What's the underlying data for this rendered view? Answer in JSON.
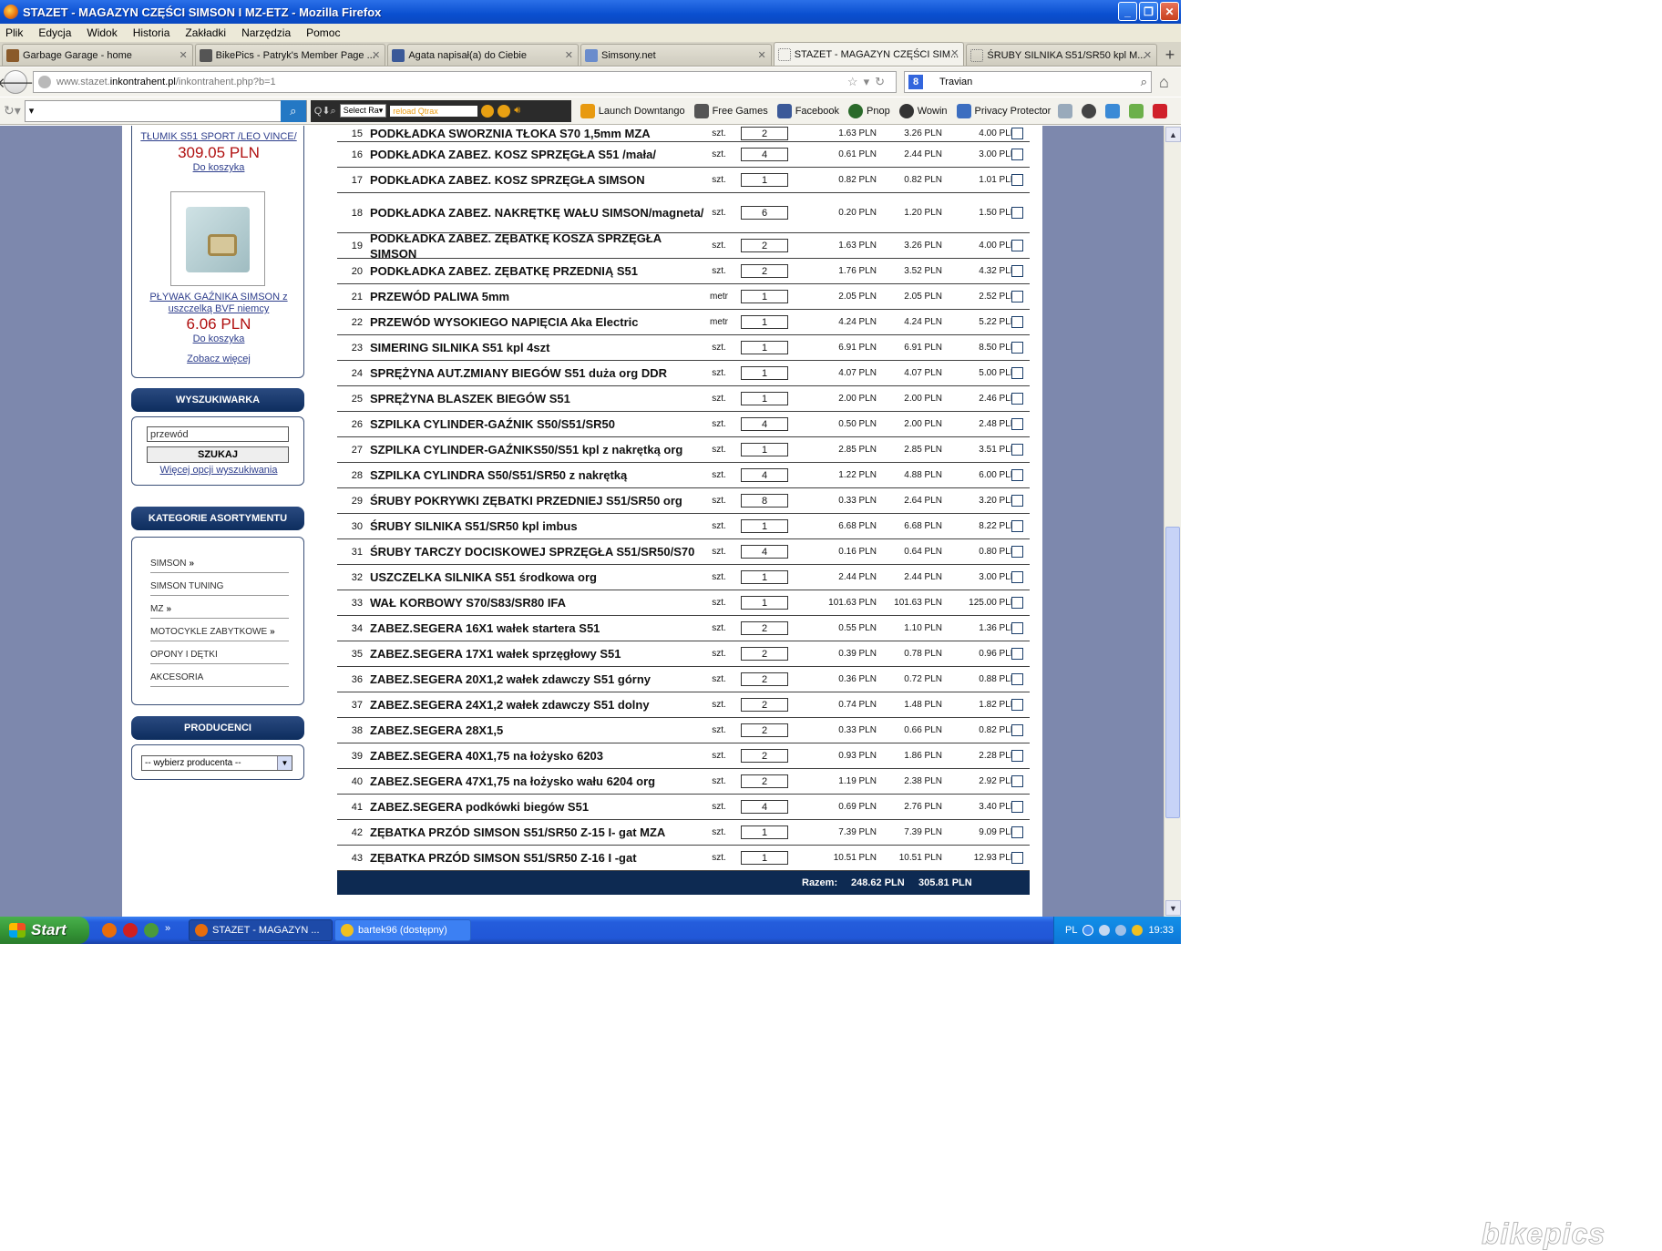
{
  "window": {
    "title": "STAZET - MAGAZYN CZĘŚCI SIMSON I MZ-ETZ - Mozilla Firefox",
    "controls": [
      "_",
      "❐",
      "✕"
    ]
  },
  "menu": [
    "Plik",
    "Edycja",
    "Widok",
    "Historia",
    "Zakładki",
    "Narzędzia",
    "Pomoc"
  ],
  "tabs": [
    {
      "label": "Garbage Garage - home",
      "color": "#8a5a2a"
    },
    {
      "label": "BikePics - Patryk's Member Page ...",
      "color": "#555555"
    },
    {
      "label": "Agata napisał(a) do Ciebie",
      "color": "#3b5998"
    },
    {
      "label": "Simsony.net",
      "color": "#6a8ccc"
    },
    {
      "label": "STAZET - MAGAZYN CZĘŚCI SIM...",
      "color": "#ffffff"
    },
    {
      "label": "ŚRUBY SILNIKA S51/SR50 kpl M...",
      "color": "#ffffff"
    }
  ],
  "address": {
    "prefix": "www.stazet.",
    "domain": "inkontrahent.pl",
    "path": "/inkontrahent.php?b=1",
    "search_engine_icon": "8",
    "search_text": "Travian"
  },
  "toolbar": {
    "search_prefix": "▾",
    "select": "Select Ra▾",
    "reload": "reload Qtrax",
    "items": [
      {
        "label": "Launch Downtango",
        "color": "#e89a10"
      },
      {
        "label": "Free Games",
        "color": "#555555"
      },
      {
        "label": "Facebook",
        "color": "#3b5998"
      },
      {
        "label": "Pnop",
        "color": "#2a6a2a"
      },
      {
        "label": "Wowin",
        "color": "#333333"
      },
      {
        "label": "Privacy Protector",
        "color": "#3c6ec0"
      }
    ]
  },
  "sidebar": {
    "product1": {
      "name": "TŁUMIK S51 SPORT /LEO VINCE/",
      "price": "309.05 PLN",
      "cart": "Do koszyka"
    },
    "product2": {
      "name_line1": "PŁYWAK GAŹNIKA SIMSON z",
      "name_line2": "uszczelką BVF niemcy",
      "price": "6.06 PLN",
      "cart": "Do koszyka"
    },
    "see_more": "Zobacz więcej",
    "search": {
      "heading": "WYSZUKIWARKA",
      "value": "przewód",
      "button": "SZUKAJ",
      "more": "Więcej opcji wyszukiwania"
    },
    "categories": {
      "heading": "KATEGORIE ASORTYMENTU",
      "items": [
        {
          "label": "SIMSON",
          "more": "»"
        },
        {
          "label": "SIMSON TUNING",
          "more": ""
        },
        {
          "label": "MZ",
          "more": "»"
        },
        {
          "label": "MOTOCYKLE ZABYTKOWE",
          "more": "»"
        },
        {
          "label": "OPONY I DĘTKI",
          "more": ""
        },
        {
          "label": "AKCESORIA",
          "more": ""
        }
      ]
    },
    "producers": {
      "heading": "PRODUCENCI",
      "select": "-- wybierz producenta --"
    }
  },
  "cart": {
    "rows": [
      {
        "n": "15",
        "name": "PODKŁADKA SWORZNIA TŁOKA S70 1,5mm MZA",
        "unit": "szt.",
        "qty": "2",
        "net": "1.63 PLN",
        "total_net": "3.26 PLN",
        "total_gross": "4.00 PLN"
      },
      {
        "n": "16",
        "name": "PODKŁADKA ZABEZ. KOSZ SPRZĘGŁA S51 /mała/",
        "unit": "szt.",
        "qty": "4",
        "net": "0.61 PLN",
        "total_net": "2.44 PLN",
        "total_gross": "3.00 PLN"
      },
      {
        "n": "17",
        "name": "PODKŁADKA ZABEZ. KOSZ SPRZĘGŁA SIMSON",
        "unit": "szt.",
        "qty": "1",
        "net": "0.82 PLN",
        "total_net": "0.82 PLN",
        "total_gross": "1.01 PLN"
      },
      {
        "n": "18",
        "name": "PODKŁADKA ZABEZ. NAKRĘTKĘ WAŁU SIMSON/magneta/",
        "unit": "szt.",
        "qty": "6",
        "net": "0.20 PLN",
        "total_net": "1.20 PLN",
        "total_gross": "1.50 PLN"
      },
      {
        "n": "19",
        "name": "PODKŁADKA ZABEZ. ZĘBATKĘ KOSZA SPRZĘGŁA SIMSON",
        "unit": "szt.",
        "qty": "2",
        "net": "1.63 PLN",
        "total_net": "3.26 PLN",
        "total_gross": "4.00 PLN"
      },
      {
        "n": "20",
        "name": "PODKŁADKA ZABEZ. ZĘBATKĘ PRZEDNIĄ S51",
        "unit": "szt.",
        "qty": "2",
        "net": "1.76 PLN",
        "total_net": "3.52 PLN",
        "total_gross": "4.32 PLN"
      },
      {
        "n": "21",
        "name": "PRZEWÓD PALIWA 5mm",
        "unit": "metr",
        "qty": "1",
        "net": "2.05 PLN",
        "total_net": "2.05 PLN",
        "total_gross": "2.52 PLN"
      },
      {
        "n": "22",
        "name": "PRZEWÓD WYSOKIEGO NAPIĘCIA Aka Electric",
        "unit": "metr",
        "qty": "1",
        "net": "4.24 PLN",
        "total_net": "4.24 PLN",
        "total_gross": "5.22 PLN"
      },
      {
        "n": "23",
        "name": "SIMERING SILNIKA S51 kpl 4szt",
        "unit": "szt.",
        "qty": "1",
        "net": "6.91 PLN",
        "total_net": "6.91 PLN",
        "total_gross": "8.50 PLN"
      },
      {
        "n": "24",
        "name": "SPRĘŻYNA AUT.ZMIANY BIEGÓW S51 duża org DDR",
        "unit": "szt.",
        "qty": "1",
        "net": "4.07 PLN",
        "total_net": "4.07 PLN",
        "total_gross": "5.00 PLN"
      },
      {
        "n": "25",
        "name": "SPRĘŻYNA BLASZEK BIEGÓW S51",
        "unit": "szt.",
        "qty": "1",
        "net": "2.00 PLN",
        "total_net": "2.00 PLN",
        "total_gross": "2.46 PLN"
      },
      {
        "n": "26",
        "name": "SZPILKA CYLINDER-GAŹNIK S50/S51/SR50",
        "unit": "szt.",
        "qty": "4",
        "net": "0.50 PLN",
        "total_net": "2.00 PLN",
        "total_gross": "2.48 PLN"
      },
      {
        "n": "27",
        "name": "SZPILKA CYLINDER-GAŹNIKS50/S51 kpl z nakrętką org",
        "unit": "szt.",
        "qty": "1",
        "net": "2.85 PLN",
        "total_net": "2.85 PLN",
        "total_gross": "3.51 PLN"
      },
      {
        "n": "28",
        "name": "SZPILKA CYLINDRA S50/S51/SR50 z nakrętką",
        "unit": "szt.",
        "qty": "4",
        "net": "1.22 PLN",
        "total_net": "4.88 PLN",
        "total_gross": "6.00 PLN"
      },
      {
        "n": "29",
        "name": "ŚRUBY POKRYWKI ZĘBATKI PRZEDNIEJ S51/SR50 org",
        "unit": "szt.",
        "qty": "8",
        "net": "0.33 PLN",
        "total_net": "2.64 PLN",
        "total_gross": "3.20 PLN"
      },
      {
        "n": "30",
        "name": "ŚRUBY SILNIKA S51/SR50 kpl imbus",
        "unit": "szt.",
        "qty": "1",
        "net": "6.68 PLN",
        "total_net": "6.68 PLN",
        "total_gross": "8.22 PLN"
      },
      {
        "n": "31",
        "name": "ŚRUBY TARCZY DOCISKOWEJ SPRZĘGŁA S51/SR50/S70",
        "unit": "szt.",
        "qty": "4",
        "net": "0.16 PLN",
        "total_net": "0.64 PLN",
        "total_gross": "0.80 PLN"
      },
      {
        "n": "32",
        "name": "USZCZELKA SILNIKA S51 środkowa org",
        "unit": "szt.",
        "qty": "1",
        "net": "2.44 PLN",
        "total_net": "2.44 PLN",
        "total_gross": "3.00 PLN"
      },
      {
        "n": "33",
        "name": "WAŁ KORBOWY S70/S83/SR80 IFA",
        "unit": "szt.",
        "qty": "1",
        "net": "101.63 PLN",
        "total_net": "101.63 PLN",
        "total_gross": "125.00 PLN"
      },
      {
        "n": "34",
        "name": "ZABEZ.SEGERA 16X1 wałek startera S51",
        "unit": "szt.",
        "qty": "2",
        "net": "0.55 PLN",
        "total_net": "1.10 PLN",
        "total_gross": "1.36 PLN"
      },
      {
        "n": "35",
        "name": "ZABEZ.SEGERA 17X1 wałek sprzęgłowy S51",
        "unit": "szt.",
        "qty": "2",
        "net": "0.39 PLN",
        "total_net": "0.78 PLN",
        "total_gross": "0.96 PLN"
      },
      {
        "n": "36",
        "name": "ZABEZ.SEGERA 20X1,2 wałek zdawczy S51 górny",
        "unit": "szt.",
        "qty": "2",
        "net": "0.36 PLN",
        "total_net": "0.72 PLN",
        "total_gross": "0.88 PLN"
      },
      {
        "n": "37",
        "name": "ZABEZ.SEGERA 24X1,2 wałek zdawczy S51 dolny",
        "unit": "szt.",
        "qty": "2",
        "net": "0.74 PLN",
        "total_net": "1.48 PLN",
        "total_gross": "1.82 PLN"
      },
      {
        "n": "38",
        "name": "ZABEZ.SEGERA 28X1,5",
        "unit": "szt.",
        "qty": "2",
        "net": "0.33 PLN",
        "total_net": "0.66 PLN",
        "total_gross": "0.82 PLN"
      },
      {
        "n": "39",
        "name": "ZABEZ.SEGERA 40X1,75 na łożysko 6203",
        "unit": "szt.",
        "qty": "2",
        "net": "0.93 PLN",
        "total_net": "1.86 PLN",
        "total_gross": "2.28 PLN"
      },
      {
        "n": "40",
        "name": "ZABEZ.SEGERA 47X1,75 na łożysko wału 6204 org",
        "unit": "szt.",
        "qty": "2",
        "net": "1.19 PLN",
        "total_net": "2.38 PLN",
        "total_gross": "2.92 PLN"
      },
      {
        "n": "41",
        "name": "ZABEZ.SEGERA podkówki biegów S51",
        "unit": "szt.",
        "qty": "4",
        "net": "0.69 PLN",
        "total_net": "2.76 PLN",
        "total_gross": "3.40 PLN"
      },
      {
        "n": "42",
        "name": "ZĘBATKA PRZÓD SIMSON S51/SR50 Z-15 I- gat MZA",
        "unit": "szt.",
        "qty": "1",
        "net": "7.39 PLN",
        "total_net": "7.39 PLN",
        "total_gross": "9.09 PLN"
      },
      {
        "n": "43",
        "name": "ZĘBATKA PRZÓD SIMSON S51/SR50 Z-16 I -gat",
        "unit": "szt.",
        "qty": "1",
        "net": "10.51 PLN",
        "total_net": "10.51 PLN",
        "total_gross": "12.93 PLN"
      }
    ],
    "summary": {
      "label": "Razem:",
      "net": "248.62 PLN",
      "gross": "305.81 PLN"
    }
  },
  "taskbar": {
    "start": "Start",
    "more": "»",
    "items": [
      {
        "label": "STAZET - MAGAZYN ...",
        "active": true,
        "color": "#e86d0c"
      },
      {
        "label": "bartek96 (dostępny)",
        "active": false,
        "color": "#f0c020"
      }
    ],
    "lang": "PL",
    "clock": "19:33"
  },
  "watermark": "bikepics"
}
